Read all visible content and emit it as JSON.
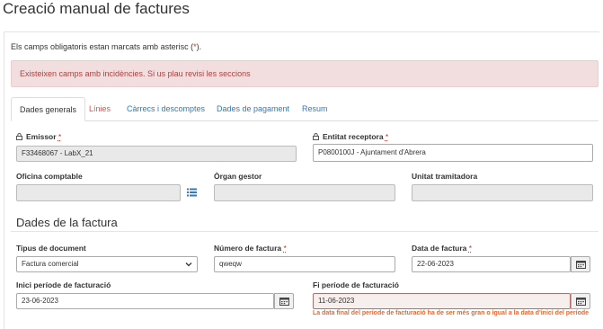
{
  "page": {
    "title": "Creació manual de factures",
    "required_note": "Els camps obligatoris estan marcats amb asterisc (",
    "required_asterisk": "*",
    "required_note_end": ").",
    "alert": "Existeixen camps amb incidències. Si us plau revisi les seccions"
  },
  "tabs": [
    {
      "label": "Dades generals",
      "state": "active"
    },
    {
      "label": "Línies",
      "state": "error"
    },
    {
      "label": "Càrrecs i descomptes",
      "state": "normal"
    },
    {
      "label": "Dades de pagament",
      "state": "normal"
    },
    {
      "label": "Resum",
      "state": "normal"
    }
  ],
  "general": {
    "emissor_label": "Emissor",
    "emissor_value": "F33468067 - LabX_21",
    "entitat_label": "Entitat receptora",
    "entitat_value": "P0800100J - Ajuntament d'Abrera",
    "oficina_label": "Oficina comptable",
    "oficina_value": "",
    "organ_label": "Òrgan gestor",
    "organ_value": "",
    "unitat_label": "Unitat tramitadora",
    "unitat_value": ""
  },
  "factura": {
    "section_title": "Dades de la factura",
    "tipus_label": "Tipus de document",
    "tipus_value": "Factura comercial",
    "numero_label": "Número de factura",
    "numero_value": "qweqw",
    "data_label": "Data de factura",
    "data_value": "22-06-2023",
    "inici_label": "Inici període de facturació",
    "inici_value": "23-06-2023",
    "fi_label": "Fi període de facturació",
    "fi_value": "11-06-2023",
    "fi_error": "La data final del període de facturació ha de ser més gran o igual a la data d'inici del període"
  },
  "colors": {
    "link": "#337ab7",
    "error_tab": "#d9534f",
    "alert_bg": "#f2dede",
    "alert_text": "#a94442",
    "error_text": "#e8672e"
  }
}
